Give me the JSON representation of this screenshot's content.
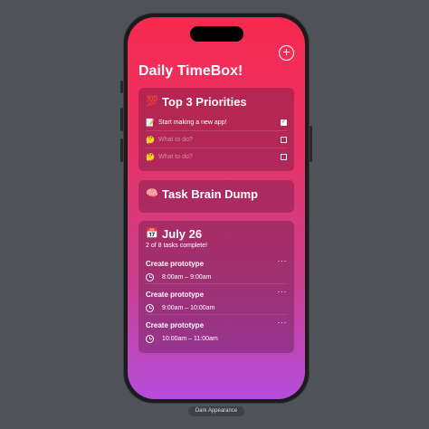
{
  "app": {
    "title": "Daily TimeBox!",
    "add_icon": "plus-circle-icon"
  },
  "priorities": {
    "emoji": "💯",
    "heading": "Top 3 Priorities",
    "items": [
      {
        "emoji": "📝",
        "text": "Start making a new app!",
        "placeholder": false,
        "checked": true
      },
      {
        "emoji": "🤔",
        "text": "What to do?",
        "placeholder": true,
        "checked": false
      },
      {
        "emoji": "🤔",
        "text": "What to do?",
        "placeholder": true,
        "checked": false
      }
    ]
  },
  "brain_dump": {
    "emoji": "🧠",
    "heading": "Task Brain Dump"
  },
  "schedule": {
    "emoji": "📅",
    "date": "July 26",
    "summary": "2 of 8 tasks complete!",
    "tasks": [
      {
        "name": "Create prototype",
        "time": "8:00am – 9:00am",
        "more": "···"
      },
      {
        "name": "Create prototype",
        "time": "9:00am – 10:00am",
        "more": "···"
      },
      {
        "name": "Create prototype",
        "time": "10:00am – 11:00am",
        "more": "···"
      }
    ]
  },
  "footer": {
    "badge": "Dark Appearance"
  },
  "colors": {
    "gradient_top": "#f7294f",
    "gradient_bottom": "#b54ddc",
    "background": "#4f5358"
  }
}
